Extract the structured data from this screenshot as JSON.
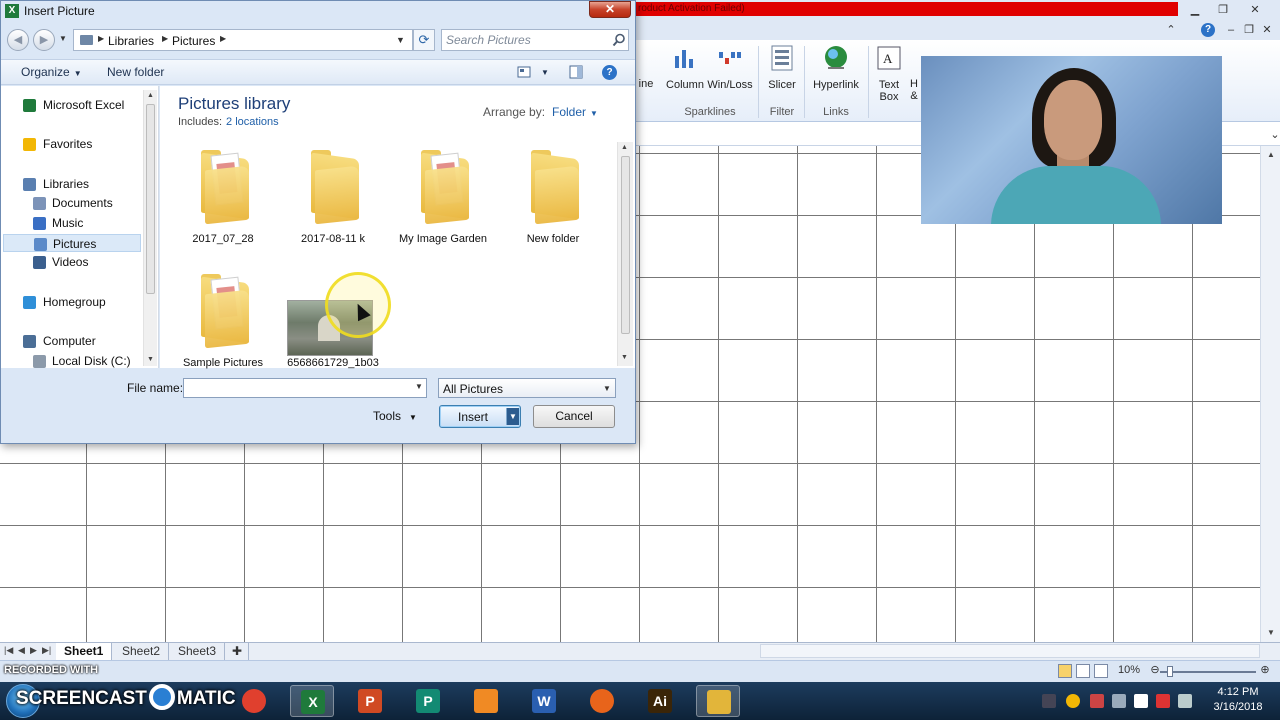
{
  "excel": {
    "activation_text": "roduct Activation Failed)",
    "ribbon": {
      "buttons": [
        {
          "label": "ine"
        },
        {
          "label": "Column"
        },
        {
          "label": "Win/Loss"
        },
        {
          "label": "Slicer"
        },
        {
          "label": "Hyperlink"
        },
        {
          "label": "Text Box"
        },
        {
          "label": "H &"
        }
      ],
      "groups": [
        "Sparklines",
        "Filter",
        "Links"
      ]
    },
    "sheets": [
      "Sheet1",
      "Sheet2",
      "Sheet3"
    ],
    "active_sheet": "Sheet1",
    "status": {
      "recorded_with": "RECORDED WITH",
      "zoom": "10%",
      "zoom_fraction": 0.1
    }
  },
  "dialog": {
    "title": "Insert Picture",
    "close_glyph": "✕",
    "breadcrumbs": [
      "Libraries",
      "Pictures"
    ],
    "search_placeholder": "Search Pictures",
    "commands": {
      "organize": "Organize",
      "new_folder": "New folder"
    },
    "nav_items": [
      {
        "label": "Microsoft Excel",
        "icon": "excel-icon",
        "color": "#1f7a3b"
      },
      {
        "label": "Favorites",
        "icon": "star-icon",
        "color": "#f2b705"
      },
      {
        "label": "Libraries",
        "icon": "libraries-icon",
        "color": "#5a7fb0"
      },
      {
        "label": "Documents",
        "icon": "documents-icon",
        "color": "#7c93b8"
      },
      {
        "label": "Music",
        "icon": "music-icon",
        "color": "#3a6fc4"
      },
      {
        "label": "Pictures",
        "icon": "pictures-icon",
        "color": "#5b8ac9"
      },
      {
        "label": "Videos",
        "icon": "videos-icon",
        "color": "#3b5f8e"
      },
      {
        "label": "Homegroup",
        "icon": "homegroup-icon",
        "color": "#2f8fd8"
      },
      {
        "label": "Computer",
        "icon": "computer-icon",
        "color": "#4b6e96"
      },
      {
        "label": "Local Disk (C:)",
        "icon": "disk-icon",
        "color": "#8c9aaa"
      }
    ],
    "selected_nav": "Pictures",
    "library": {
      "title": "Pictures library",
      "includes_label": "Includes:",
      "locations": "2 locations",
      "arrange_label": "Arrange by:",
      "arrange_value": "Folder"
    },
    "files": [
      {
        "name": "2017_07_28",
        "type": "folder",
        "paper": "red"
      },
      {
        "name": "2017-08-11 k",
        "type": "folder",
        "paper": "none"
      },
      {
        "name": "My Image Garden",
        "type": "folder",
        "paper": "red"
      },
      {
        "name": "New folder",
        "type": "folder",
        "paper": "none"
      },
      {
        "name": "Sample Pictures",
        "type": "folder",
        "paper": "red"
      },
      {
        "name": "6568661729_1b03",
        "type": "image",
        "paper": "none"
      }
    ],
    "file_name_label": "File name:",
    "file_name_value": "",
    "filter_value": "All Pictures",
    "tools_label": "Tools",
    "insert_label": "Insert",
    "cancel_label": "Cancel"
  },
  "taskbar": {
    "screencast": "SCREENCAST",
    "matic": "MATIC",
    "apps": [
      {
        "name": "chrome-icon",
        "glyph": "",
        "color": "#e0402e",
        "active": false
      },
      {
        "name": "excel-icon",
        "glyph": "X",
        "color": "#1f7a3b",
        "active": true
      },
      {
        "name": "powerpoint-icon",
        "glyph": "P",
        "color": "#d04a23",
        "active": false
      },
      {
        "name": "publisher-icon",
        "glyph": "P",
        "color": "#138a73",
        "active": false
      },
      {
        "name": "app-orange-icon",
        "glyph": "",
        "color": "#f08a24",
        "active": false
      },
      {
        "name": "word-icon",
        "glyph": "W",
        "color": "#2a5fb0",
        "active": false
      },
      {
        "name": "firefox-icon",
        "glyph": "",
        "color": "#e8641b",
        "active": false
      },
      {
        "name": "illustrator-icon",
        "glyph": "Ai",
        "color": "#3a2508",
        "active": false
      },
      {
        "name": "recorder-icon",
        "glyph": "",
        "color": "#e2b53a",
        "active": true
      }
    ],
    "time": "4:12 PM",
    "date": "3/16/2018"
  }
}
